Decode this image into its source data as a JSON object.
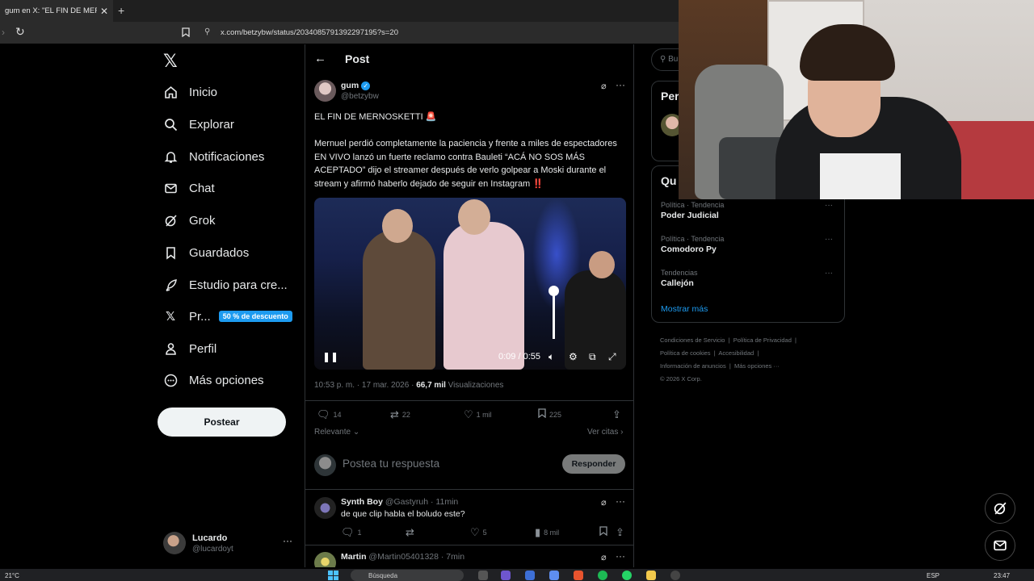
{
  "browser": {
    "tab_title": "gum en X: \"EL FIN DE MERNOSKETTI\"",
    "url": "x.com/betzybw/status/2034085791392297195?s=20"
  },
  "sidebar": {
    "items": [
      {
        "label": "Inicio",
        "icon": "home-icon"
      },
      {
        "label": "Explorar",
        "icon": "search-icon"
      },
      {
        "label": "Notificaciones",
        "icon": "bell-icon"
      },
      {
        "label": "Chat",
        "icon": "mail-icon"
      },
      {
        "label": "Grok",
        "icon": "grok-icon"
      },
      {
        "label": "Guardados",
        "icon": "bookmark-icon"
      },
      {
        "label": "Estudio para cre...",
        "icon": "rocket-icon"
      },
      {
        "label": "Pr...",
        "icon": "x-premium-icon"
      },
      {
        "label": "Perfil",
        "icon": "person-icon"
      },
      {
        "label": "Más opciones",
        "icon": "more-circle-icon"
      }
    ],
    "premium_badge": "50 % de descuento",
    "post_button": "Postear",
    "user": {
      "name": "Lucardo",
      "handle": "@lucardoyt"
    }
  },
  "post": {
    "header_title": "Post",
    "author_name": "gum",
    "author_handle": "@betzybw",
    "headline": "EL FIN DE MERNOSKETTI 🚨",
    "body": "Mernuel perdió completamente la paciencia y frente a miles de espectadores EN VIVO lanzó un fuerte reclamo contra Bauleti “ACÁ NO SOS MÁS ACEPTADO” dijo el streamer después de verlo golpear a Moski durante el stream y afirmó haberlo dejado de seguir en Instagram ‼️",
    "video_time": "0:09 / 0:55",
    "volume_level": 0.85,
    "timestamp": "10:53 p. m. · 17 mar. 2026 ·",
    "views_count": "66,7 mil",
    "views_label": "Visualizaciones",
    "stats": {
      "replies": "14",
      "reposts": "22",
      "likes": "1 mil",
      "bookmarks": "225"
    },
    "relevance": "Relevante",
    "quotes_link": "Ver citas",
    "reply_placeholder": "Postea tu respuesta",
    "reply_button": "Responder"
  },
  "comments": [
    {
      "name": "Synth Boy",
      "handle": "@Gastyruh · 11min",
      "text": "de que clip habla el  boludo este?",
      "replies": "1",
      "likes": "5",
      "views": "8 mil"
    },
    {
      "name": "Martin",
      "handle": "@Martin05401328 · 7min",
      "text": ""
    }
  ],
  "right": {
    "search_placeholder": "Bu",
    "who_title": "Per",
    "trends_title": "Qu",
    "trends": [
      {
        "category": "Política · Tendencia",
        "name": "Poder Judicial"
      },
      {
        "category": "Política · Tendencia",
        "name": "Comodoro Py"
      },
      {
        "category": "Tendencias",
        "name": "Callejón"
      }
    ],
    "show_more": "Mostrar más",
    "footer": [
      "Condiciones de Servicio",
      "Política de Privacidad",
      "Política de cookies",
      "Accesibilidad",
      "Información de anuncios",
      "Más opciones ···",
      "© 2026 X Corp."
    ]
  },
  "taskbar": {
    "weather": "21°C",
    "search_label": "Búsqueda",
    "lang": "ESP",
    "time": "23:47"
  },
  "colors": {
    "accent": "#1d9bf0",
    "background": "#000000",
    "border": "#2f3336",
    "muted": "#71767b"
  }
}
